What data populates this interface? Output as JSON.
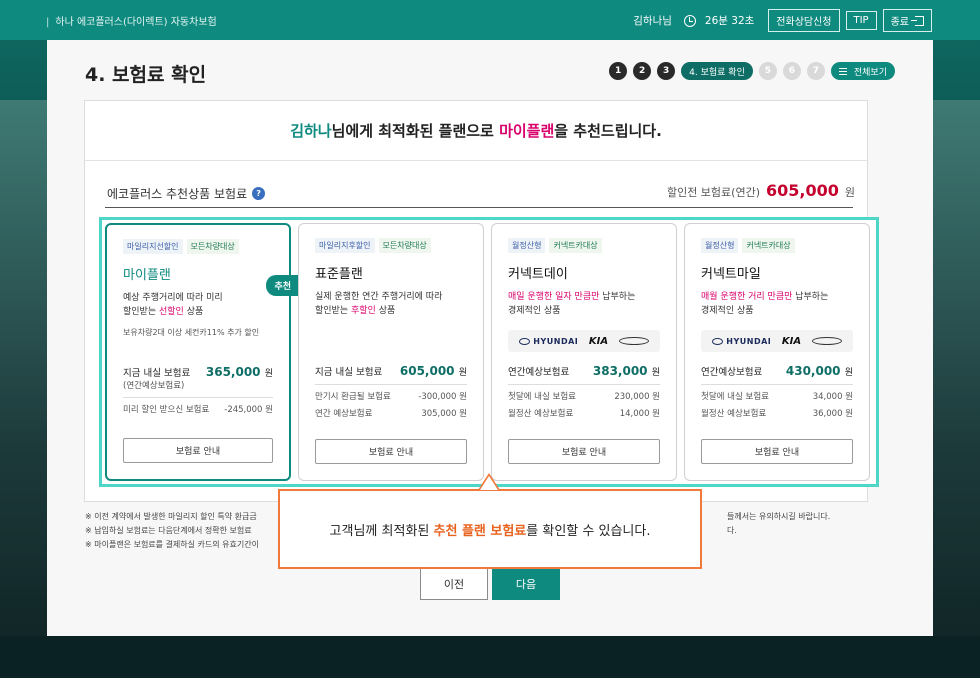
{
  "header": {
    "service": "하나 에코플러스(다이렉트) 자동차보험",
    "user": "김하나님",
    "timer": "26분 32초",
    "buttons": {
      "call": "전화상담신청",
      "tip": "TIP",
      "exit": "종료"
    }
  },
  "page": {
    "title": "4. 보험료 확인",
    "steps": [
      "1",
      "2",
      "3",
      "4. 보험료 확인",
      "5",
      "6",
      "7"
    ],
    "view_all": "전체보기"
  },
  "headline": {
    "name": "김하나",
    "part1": "님에게 최적화된 플랜으로 ",
    "plan": "마이플랜",
    "part2": "을 추천드립니다."
  },
  "section": {
    "title": "에코플러스 추천상품 보험료",
    "help_icon": "?",
    "premium_label": "할인전 보험료(연간)",
    "premium_amount": "605,000",
    "premium_unit": "원"
  },
  "cards": [
    {
      "tags": [
        "마일리지선할인",
        "모든차량대상"
      ],
      "name": "마이플랜",
      "desc1": "예상 주행거리에 따라 미리",
      "desc2a": "할인받는 ",
      "desc2hl": "선할인",
      "desc2b": " 상품",
      "sub": "보유차량2대 이상 세컨카11% 추가 할인",
      "badge": "추천",
      "main_label": "지금 내실 보험료",
      "main_value": "365,000",
      "unit": "원",
      "main_sub": "(연간예상보험료)",
      "rows": [
        {
          "label": "미리 할인 받으신 보험료",
          "value": "-245,000 원"
        }
      ],
      "button": "보험료 안내"
    },
    {
      "tags": [
        "마일리지후할인",
        "모든차량대상"
      ],
      "name": "표준플랜",
      "desc1": "실제 운행한 연간 주행거리에 따라",
      "desc2a": "할인받는 ",
      "desc2hl": "후할인",
      "desc2b": " 상품",
      "main_label": "지금 내실 보험료",
      "main_value": "605,000",
      "unit": "원",
      "rows": [
        {
          "label": "만기시 환급될 보험료",
          "value": "-300,000 원"
        },
        {
          "label": "연간 예상보험료",
          "value": "305,000 원"
        }
      ],
      "button": "보험료 안내"
    },
    {
      "tags": [
        "월정산형",
        "커넥트카대상"
      ],
      "name": "커넥트데이",
      "desc_hl": "매일 운행한 일자 만큼만",
      "desc1b": " 납부하는",
      "desc2": "경제적인 상품",
      "logos": {
        "hyundai": "HYUNDAI",
        "kia": "KIA",
        "genesis": "genesis-logo"
      },
      "main_label": "연간예상보험료",
      "main_value": "383,000",
      "unit": "원",
      "rows": [
        {
          "label": "첫달에 내실 보험료",
          "value": "230,000 원"
        },
        {
          "label": "월정산 예상보험료",
          "value": "14,000 원"
        }
      ],
      "button": "보험료 안내"
    },
    {
      "tags": [
        "월정산형",
        "커넥트카대상"
      ],
      "name": "커넥트마일",
      "desc_hl": "매월 운행한 거리 만큼만",
      "desc1b": " 납부하는",
      "desc2": "경제적인 상품",
      "logos": {
        "hyundai": "HYUNDAI",
        "kia": "KIA",
        "genesis": "genesis-logo"
      },
      "main_label": "연간예상보험료",
      "main_value": "430,000",
      "unit": "원",
      "rows": [
        {
          "label": "첫달에 내실 보험료",
          "value": "34,000 원"
        },
        {
          "label": "월정산 예상보험료",
          "value": "36,000 원"
        }
      ],
      "button": "보험료 안내"
    }
  ],
  "notes": {
    "n1": "※ 이전 계약에서 발생한 마일리지 할인 특약 환급금",
    "n2": "※ 납입하실 보험료는 다음단계에서 정확한 보험료",
    "n3": "※ 마이플랜은 보험료를 결제하실 카드의 유효기간이",
    "r1": "들께서는 유의하시길 바랍니다.",
    "r2": "다."
  },
  "tooltip": {
    "part1": "고객님께 최적화된 ",
    "hl": "추천 플랜 보험료",
    "part2": "를 확인할 수 있습니다."
  },
  "nav": {
    "prev": "이전",
    "next": "다음"
  }
}
